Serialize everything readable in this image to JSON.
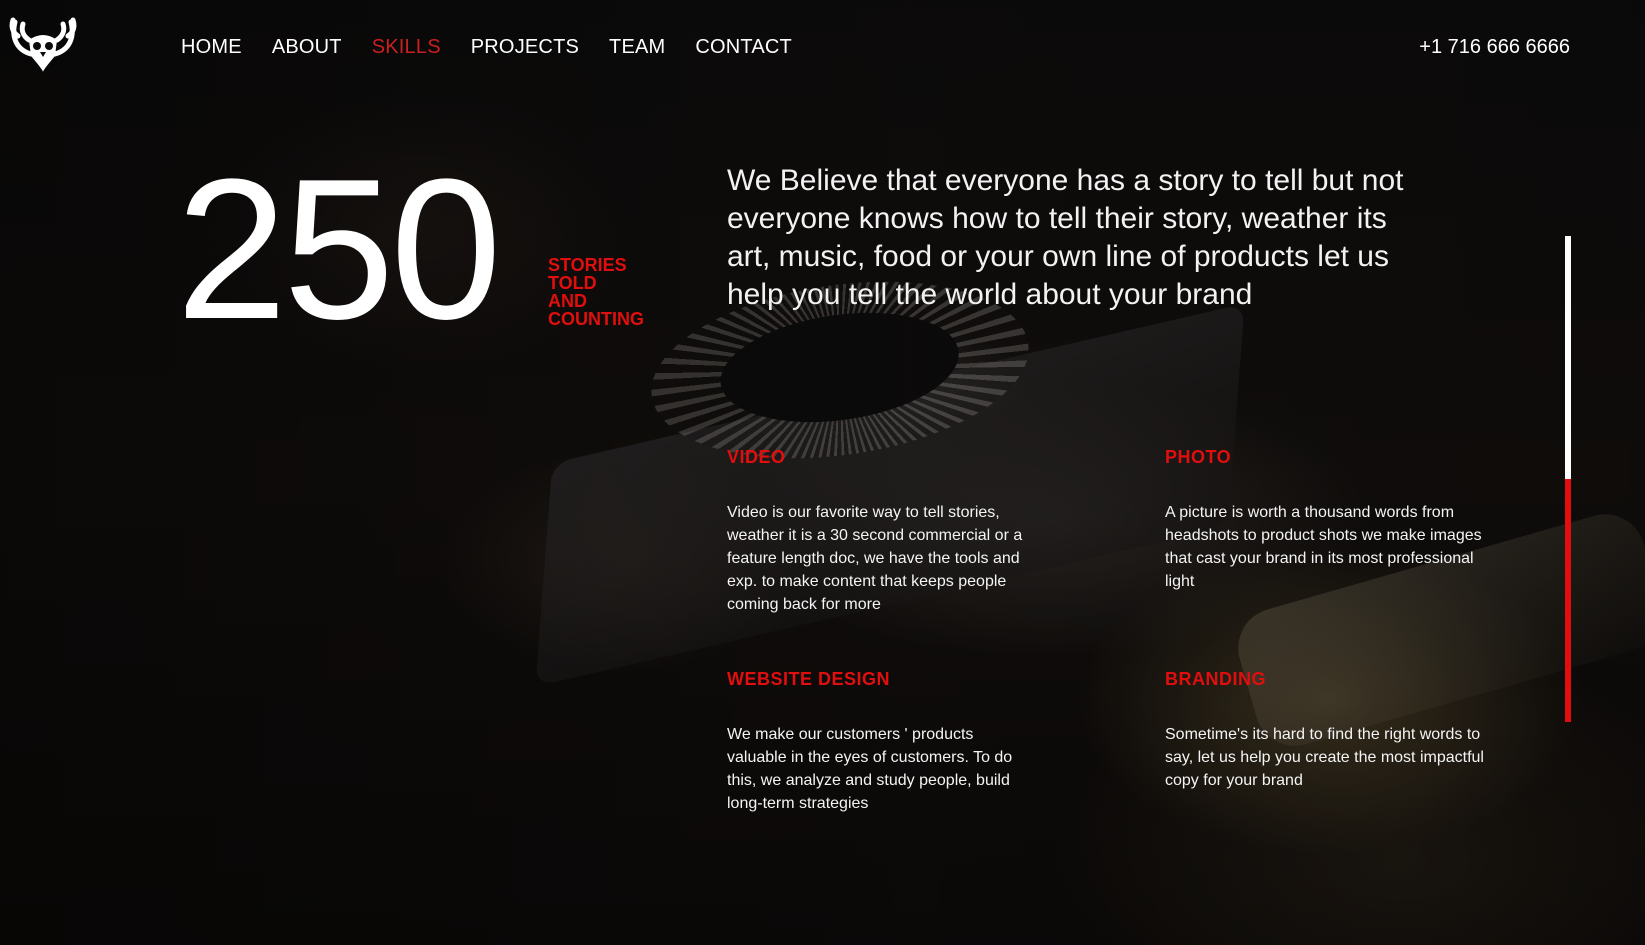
{
  "nav": {
    "items": [
      {
        "label": "HOME",
        "active": false
      },
      {
        "label": "ABOUT",
        "active": false
      },
      {
        "label": "SKILLS",
        "active": true
      },
      {
        "label": "PROJECTS",
        "active": false
      },
      {
        "label": "TEAM",
        "active": false
      },
      {
        "label": "CONTACT",
        "active": false
      }
    ]
  },
  "header": {
    "logo_icon": "owl-antlers-logo-icon",
    "phone": "+1 716 666 6666"
  },
  "stats": {
    "count": "250",
    "label_lines": [
      "STORIES",
      "TOLD",
      "AND",
      "COUNTING"
    ]
  },
  "intro": {
    "text": "We Believe that everyone has a story to tell but not everyone knows how to tell their story, weather its art, music, food or your own line of products let us help you tell the world about your brand"
  },
  "services": [
    {
      "title": "VIDEO",
      "description": "Video is our favorite way to tell stories, weather it is a 30 second commercial or a feature length doc, we have the tools and exp. to make content that keeps people coming back for more"
    },
    {
      "title": "PHOTO",
      "description": "A picture is worth a thousand words from headshots to product shots we make images that cast your brand in its most professional light"
    },
    {
      "title": "WEBSITE DESIGN",
      "description": "We make our customers ' products valuable in the eyes of customers. To do this, we analyze and study people, build long-term strategies"
    },
    {
      "title": "BRANDING",
      "description": "Sometime's its hard to find the right words to say, let us help you create the most impactful copy for your brand"
    }
  ],
  "scroll_indicator": {
    "progress": 0.5
  },
  "colors": {
    "accent": "#e10e0e",
    "nav_active": "#cc1f1f",
    "text": "#ffffff",
    "background": "#0d0b0a"
  }
}
